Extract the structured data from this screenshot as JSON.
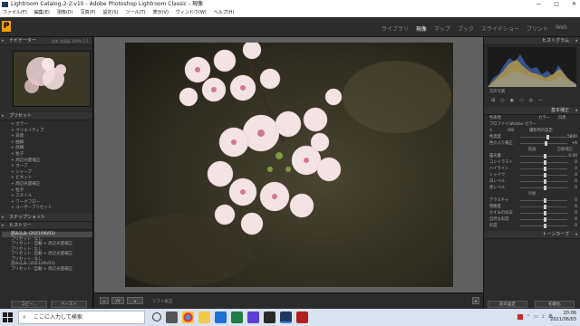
{
  "window": {
    "title": "Lightroom Catalog-2-2-v10 - Adobe Photoshop Lightroom Classic - 現像",
    "controls": [
      "—",
      "□",
      "✕"
    ]
  },
  "menu": [
    "ファイル(F)",
    "編集(E)",
    "現像(D)",
    "写真(P)",
    "設定(S)",
    "ツール(T)",
    "表示(V)",
    "ウィンドウ(W)",
    "ヘルプ(H)"
  ],
  "modules": [
    {
      "label": "ライブラリ",
      "active": false
    },
    {
      "label": "現像",
      "active": true
    },
    {
      "label": "マップ",
      "active": false
    },
    {
      "label": "ブック",
      "active": false
    },
    {
      "label": "スライドショー",
      "active": false
    },
    {
      "label": "プリント",
      "active": false
    },
    {
      "label": "Web",
      "active": false
    }
  ],
  "left": {
    "navigator_title": "ナビゲーター",
    "navigator_sub": "全体 全画面 100% 1:1",
    "presets_title": "プリセット",
    "presets": [
      "+ カラー",
      "+ クリエイティブ",
      "+ 白黒",
      "+ 曲線",
      "+ 詳細",
      "+ 粒子",
      "+ 周辺光量補正",
      "+ カーブ",
      "+ シャープ",
      "+ ビネット",
      "+ 周辺光量補正",
      "+ 粒子",
      "+ スタイル",
      "+ ワークフロー",
      "+ ユーザープリセット"
    ],
    "snapshots_title": "スナップショット",
    "history_title": "ヒストリー",
    "history": [
      "読み込み (2021/06/03)",
      "プリセット: なし",
      "プリセット: 自動 + 周辺光量補正",
      "プリセット: なし",
      "プリセット: 自動 + 周辺光量補正",
      "プリセット: なし",
      "読み込み (2021/06/03)",
      "プリセット: 自動 + 周辺光量補正"
    ],
    "copy_label": "コピー...",
    "paste_label": "ペースト"
  },
  "toolbar": {
    "label": "ソフト校正"
  },
  "right": {
    "histogram_title": "ヒストグラム",
    "original_label": "元の写真",
    "basic_title": "基本補正",
    "treatment_label": "色表現",
    "treatment_color": "カラー",
    "treatment_bw": "白黒",
    "profile_label": "プロファイル",
    "profile_value": "Adobe カラー",
    "wb_label": "WB",
    "wb_value": "撮影時の設定",
    "tone_head": "階調",
    "tone_auto": "自動補正",
    "presence_head": "外観",
    "sliders": [
      {
        "label": "色温度",
        "value": "5800",
        "pos": 0.55
      },
      {
        "label": "色かぶり補正",
        "value": "+6",
        "pos": 0.52
      },
      {
        "label": "露光量",
        "value": "0.00",
        "pos": 0.5
      },
      {
        "label": "コントラスト",
        "value": "0",
        "pos": 0.5
      },
      {
        "label": "ハイライト",
        "value": "0",
        "pos": 0.5
      },
      {
        "label": "シャドウ",
        "value": "0",
        "pos": 0.5
      },
      {
        "label": "白レベル",
        "value": "0",
        "pos": 0.5
      },
      {
        "label": "黒レベル",
        "value": "0",
        "pos": 0.5
      },
      {
        "label": "テクスチャ",
        "value": "0",
        "pos": 0.5
      },
      {
        "label": "明瞭度",
        "value": "0",
        "pos": 0.5
      },
      {
        "label": "かすみの除去",
        "value": "0",
        "pos": 0.5
      },
      {
        "label": "自然な彩度",
        "value": "0",
        "pos": 0.5
      },
      {
        "label": "彩度",
        "value": "0",
        "pos": 0.5
      }
    ],
    "tone_curve_title": "トーンカーブ",
    "prev_label": "前の設定",
    "reset_label": "初期化"
  },
  "taskbar": {
    "search_placeholder": "ここに入力して検索",
    "time": "20:06",
    "date": "2021/06/03",
    "lang": "あ"
  }
}
